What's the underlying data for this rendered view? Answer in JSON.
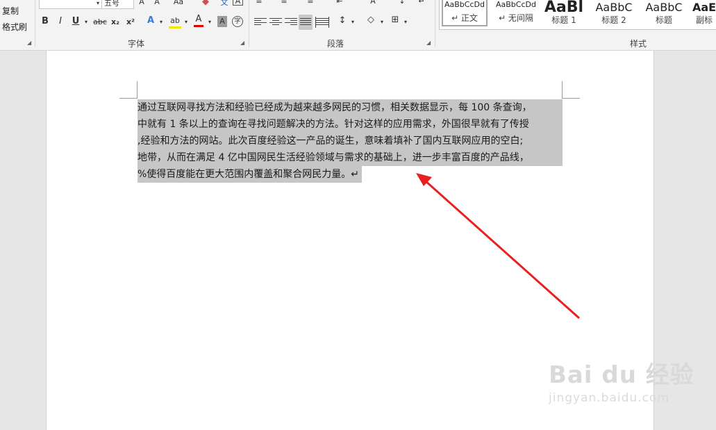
{
  "clipboard": {
    "copy_label": "复制",
    "format_painter_label": "格式刷"
  },
  "font": {
    "group_label": "字体",
    "font_size": "五号",
    "bold": "B",
    "italic": "I",
    "underline": "U",
    "strikethrough": "abc",
    "subscript": "x₂",
    "superscript": "x²",
    "grow": "A",
    "shrink": "A",
    "change_case": "Aa",
    "clear_format_icon": "eraser-icon",
    "phonetic": "文",
    "text_effects": "A",
    "highlight": "ab",
    "font_color": "A",
    "char_shading": "A",
    "enclose": "字"
  },
  "paragraph": {
    "group_label": "段落"
  },
  "styles": {
    "group_label": "样式",
    "items": [
      {
        "sample": "AaBbCcDd",
        "name": "↵ 正文"
      },
      {
        "sample": "AaBbCcDd",
        "name": "↵ 无间隔"
      },
      {
        "sample": "AaBl",
        "name": "标题 1"
      },
      {
        "sample": "AaBbC",
        "name": "标题 2"
      },
      {
        "sample": "AaBbC",
        "name": "标题"
      },
      {
        "sample": "AaE",
        "name": "副标"
      }
    ]
  },
  "document": {
    "lines": [
      "通过互联网寻找方法和经验已经成为越来越多网民的习惯，相关数据显示，每 100 条查询，",
      "中就有 1 条以上的查询在寻找问题解决的方法。针对这样的应用需求，外国很早就有了传授",
      ",经验和方法的网站。此次百度经验这一产品的诞生，意味着填补了国内互联网应用的空白;",
      "地带，从而在满足 4 亿中国网民生活经验领域与需求的基础上，进一步丰富百度的产品线，",
      "%使得百度能在更大范围内覆盖和聚合网民力量。↵"
    ]
  },
  "annotation": {
    "arrow_color": "#e82020"
  },
  "watermark": {
    "main": "Bai du 经验",
    "sub": "jingyan.baidu.com"
  }
}
